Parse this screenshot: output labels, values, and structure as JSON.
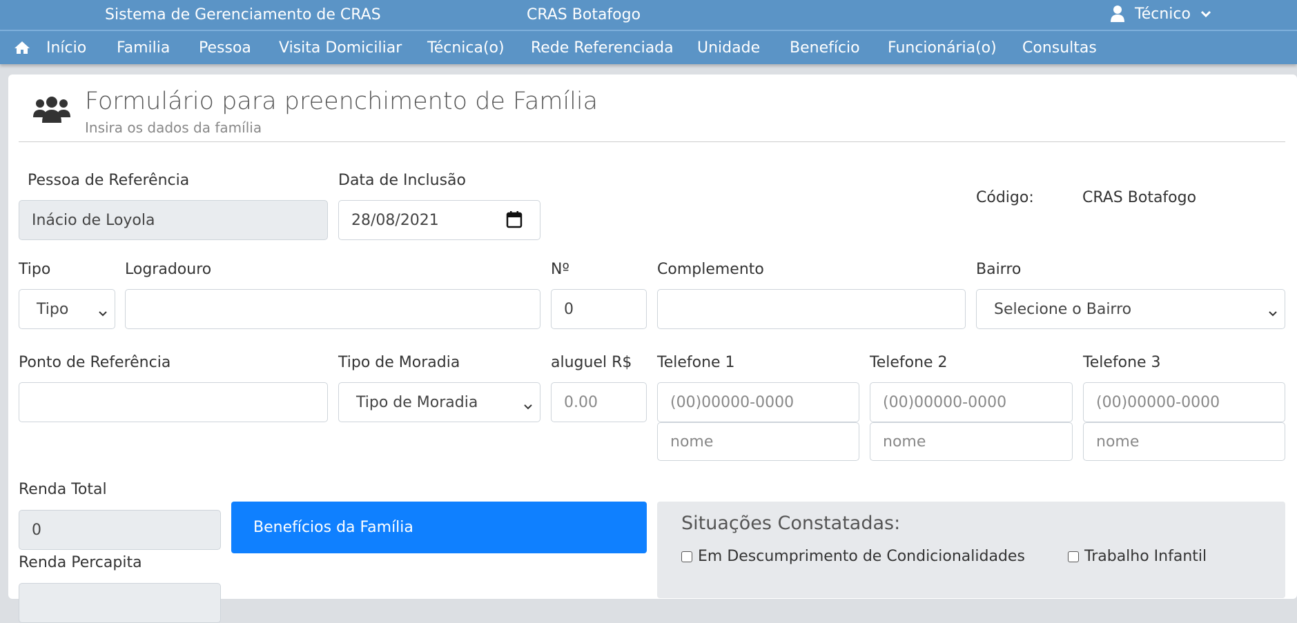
{
  "topbar": {
    "system_name": "Sistema de Gerenciamento de CRAS",
    "unit_name": "CRAS Botafogo",
    "user_label": "Técnico"
  },
  "nav": [
    "Início",
    "Familia",
    "Pessoa",
    "Visita Domiciliar",
    "Técnica(o)",
    "Rede Referenciada",
    "Unidade",
    "Benefício",
    "Funcionária(o)",
    "Consultas"
  ],
  "form": {
    "title": "Formulário para preenchimento de Família",
    "subtitle": "Insira os dados da família",
    "pessoa_ref": {
      "label": "Pessoa de Referência",
      "value": "Inácio de Loyola"
    },
    "data_inclusao": {
      "label": "Data de Inclusão",
      "value": "28/08/2021"
    },
    "codigo": {
      "label": "Código:",
      "value": "CRAS Botafogo"
    },
    "tipo": {
      "label": "Tipo",
      "value": "Tipo"
    },
    "logradouro": {
      "label": "Logradouro",
      "value": ""
    },
    "numero": {
      "label": "Nº",
      "value": "0"
    },
    "complemento": {
      "label": "Complemento",
      "value": ""
    },
    "bairro": {
      "label": "Bairro",
      "value": "Selecione o Bairro"
    },
    "ponto_ref": {
      "label": "Ponto de Referência",
      "value": ""
    },
    "tipo_moradia": {
      "label": "Tipo de Moradia",
      "value": "Tipo de Moradia"
    },
    "aluguel": {
      "label": "aluguel R$",
      "placeholder": "0.00"
    },
    "telefones": [
      {
        "label": "Telefone 1",
        "placeholder": "(00)00000-0000",
        "name_placeholder": "nome"
      },
      {
        "label": "Telefone 2",
        "placeholder": "(00)00000-0000",
        "name_placeholder": "nome"
      },
      {
        "label": "Telefone 3",
        "placeholder": "(00)00000-0000",
        "name_placeholder": "nome"
      }
    ],
    "renda_total": {
      "label": "Renda Total",
      "value": "0"
    },
    "renda_percapita": {
      "label": "Renda Percapita"
    },
    "beneficios_button": "Benefícios da Família",
    "situacoes": {
      "title": "Situações Constatadas:",
      "items": [
        "Em Descumprimento de Condicionalidades",
        "Trabalho Infantil"
      ]
    }
  },
  "colors": {
    "bar": "#5b94c6",
    "button": "#0f80ff"
  },
  "icons": [
    "home-icon",
    "user-icon",
    "chevron-down-icon",
    "users-icon",
    "calendar-icon"
  ]
}
